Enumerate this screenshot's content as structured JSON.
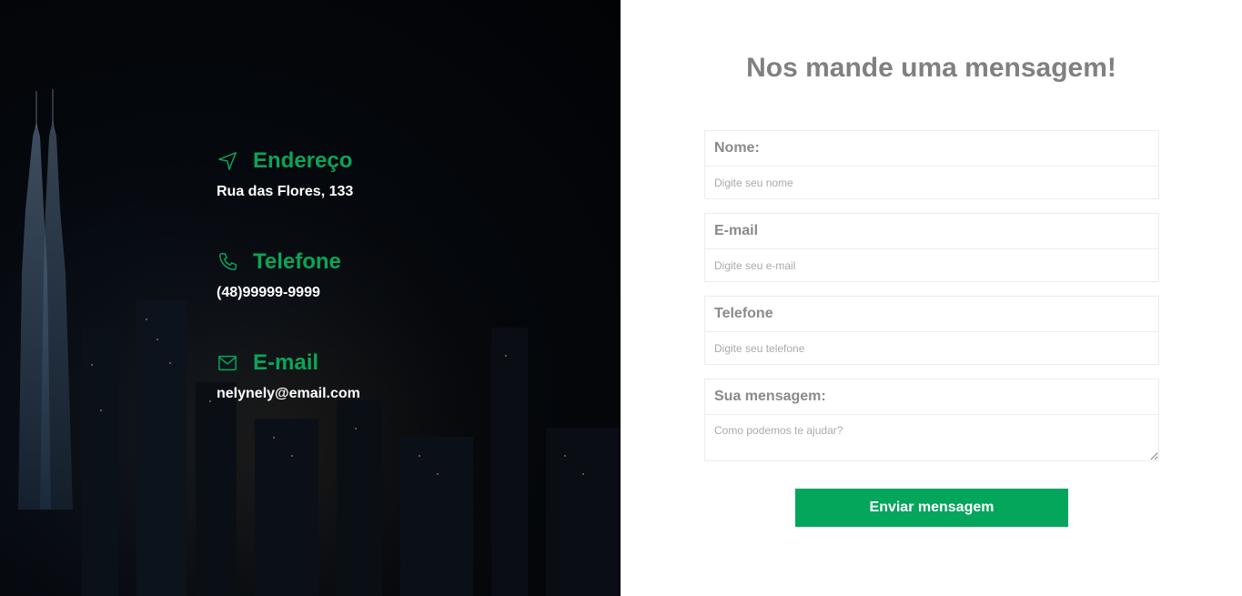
{
  "contact_info": {
    "address": {
      "title": "Endereço",
      "value": "Rua das Flores, 133",
      "icon": "navigation-arrow-icon"
    },
    "phone": {
      "title": "Telefone",
      "value": "(48)99999-9999",
      "icon": "phone-icon"
    },
    "email": {
      "title": "E-mail",
      "value": "nelynely@email.com",
      "icon": "envelope-icon"
    }
  },
  "form": {
    "title": "Nos mande uma mensagem!",
    "fields": {
      "name": {
        "label": "Nome:",
        "placeholder": "Digite seu nome",
        "value": ""
      },
      "email": {
        "label": "E-mail",
        "placeholder": "Digite seu e-mail",
        "value": ""
      },
      "phone": {
        "label": "Telefone",
        "placeholder": "Digite seu telefone",
        "value": ""
      },
      "message": {
        "label": "Sua mensagem:",
        "placeholder": "Como podemos te ajudar?",
        "value": ""
      }
    },
    "submit_label": "Enviar mensagem"
  },
  "colors": {
    "accent": "#03a65b",
    "left_panel_bg": "#05080d",
    "title_gray": "#808080"
  }
}
